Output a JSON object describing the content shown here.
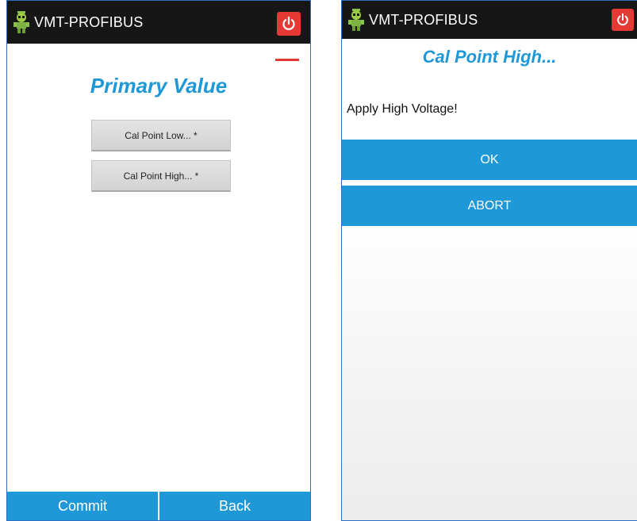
{
  "left_screen": {
    "app_title": "VMT-PROFIBUS",
    "logo_icon": "robot-logo-icon",
    "power_icon": "power-icon",
    "menu_indicator_color": "#e53935",
    "title": "Primary Value",
    "methods": [
      {
        "label": "Cal Point Low... *"
      },
      {
        "label": "Cal Point High... *"
      }
    ],
    "footer": {
      "commit_label": "Commit",
      "back_label": "Back"
    }
  },
  "right_screen": {
    "app_title": "VMT-PROFIBUS",
    "logo_icon": "robot-logo-icon",
    "power_icon": "power-icon",
    "title": "Cal Point High...",
    "message": "Apply High Voltage!",
    "ok_label": "OK",
    "abort_label": "ABORT"
  },
  "colors": {
    "accent_blue": "#1e98d6",
    "titlebar": "#161616",
    "power_red": "#e53935"
  }
}
